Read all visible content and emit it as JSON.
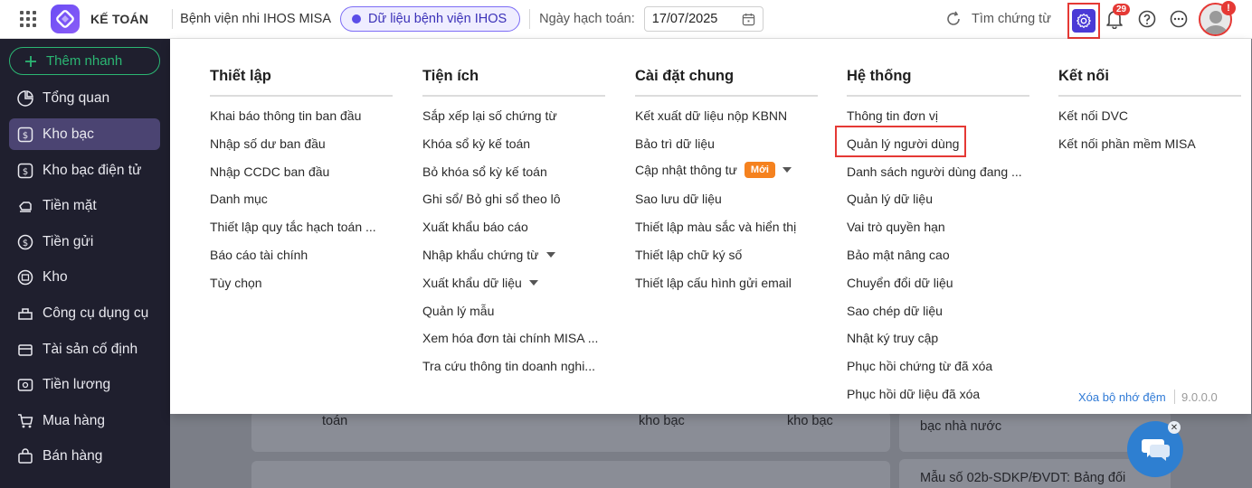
{
  "app": {
    "title": "KẾ TOÁN",
    "unit_name": "Bệnh viện nhi IHOS MISA",
    "data_source": "Dữ liệu bệnh viện IHOS",
    "posting_date_label": "Ngày hạch toán:",
    "posting_date": "17/07/2025",
    "search_doc_label": "Tìm chứng từ",
    "notification_count": "29",
    "avatar_alert": "!"
  },
  "sidebar": {
    "quick_add": "Thêm nhanh",
    "items": [
      {
        "label": "Tổng quan",
        "icon": "pie-chart-icon"
      },
      {
        "label": "Kho bạc",
        "icon": "treasury-icon",
        "active": true
      },
      {
        "label": "Kho bạc điện tử",
        "icon": "e-treasury-icon"
      },
      {
        "label": "Tiền mặt",
        "icon": "cash-icon"
      },
      {
        "label": "Tiền gửi",
        "icon": "deposit-icon"
      },
      {
        "label": "Kho",
        "icon": "warehouse-icon"
      },
      {
        "label": "Công cụ dụng cụ",
        "icon": "tools-icon"
      },
      {
        "label": "Tài sản cố định",
        "icon": "fixed-asset-icon"
      },
      {
        "label": "Tiền lương",
        "icon": "salary-icon"
      },
      {
        "label": "Mua hàng",
        "icon": "cart-icon"
      },
      {
        "label": "Bán hàng",
        "icon": "sales-icon"
      }
    ]
  },
  "background": {
    "text1": "toán",
    "text2": "kho bạc",
    "text3": "kho bạc",
    "text4": "bạc nhà nước",
    "text5": "Mẫu số 02b-SDKP/ĐVDT: Bảng đối"
  },
  "menu": {
    "columns": [
      {
        "title": "Thiết lập",
        "items": [
          {
            "label": "Khai báo thông tin ban đầu"
          },
          {
            "label": "Nhập số dư ban đầu"
          },
          {
            "label": "Nhập CCDC ban đầu"
          },
          {
            "label": "Danh mục"
          },
          {
            "label": "Thiết lập quy tắc hạch toán ..."
          },
          {
            "label": "Báo cáo tài chính"
          },
          {
            "label": "Tùy chọn"
          }
        ]
      },
      {
        "title": "Tiện ích",
        "items": [
          {
            "label": "Sắp xếp lại số chứng từ"
          },
          {
            "label": "Khóa sổ kỳ kế toán"
          },
          {
            "label": "Bỏ khóa sổ kỳ kế toán"
          },
          {
            "label": "Ghi sổ/ Bỏ ghi sổ theo lô"
          },
          {
            "label": "Xuất khẩu báo cáo"
          },
          {
            "label": "Nhập khẩu chứng từ",
            "dropdown": true
          },
          {
            "label": "Xuất khẩu dữ liệu",
            "dropdown": true
          },
          {
            "label": "Quản lý mẫu"
          },
          {
            "label": "Xem hóa đơn tài chính MISA ..."
          },
          {
            "label": "Tra cứu thông tin doanh nghi..."
          }
        ]
      },
      {
        "title": "Cài đặt chung",
        "items": [
          {
            "label": "Kết xuất dữ liệu nộp KBNN"
          },
          {
            "label": "Bảo trì dữ liệu"
          },
          {
            "label": "Cập nhật thông tư",
            "badge": "Mới",
            "dropdown": true
          },
          {
            "label": "Sao lưu dữ liệu"
          },
          {
            "label": "Thiết lập màu sắc và hiển thị"
          },
          {
            "label": "Thiết lập chữ ký số"
          },
          {
            "label": "Thiết lập cấu hình gửi email"
          }
        ]
      },
      {
        "title": "Hệ thống",
        "items": [
          {
            "label": "Thông tin đơn vị"
          },
          {
            "label": "Quản lý người dùng",
            "highlighted": true
          },
          {
            "label": "Danh sách người dùng đang ..."
          },
          {
            "label": "Quản lý dữ liệu"
          },
          {
            "label": "Vai trò quyền hạn"
          },
          {
            "label": "Bảo mật nâng cao"
          },
          {
            "label": "Chuyển đổi dữ liệu"
          },
          {
            "label": "Sao chép dữ liệu"
          },
          {
            "label": "Nhật ký truy cập"
          },
          {
            "label": "Phục hồi chứng từ đã xóa"
          },
          {
            "label": "Phục hồi dữ liệu đã xóa"
          }
        ]
      },
      {
        "title": "Kết nối",
        "items": [
          {
            "label": "Kết nối DVC"
          },
          {
            "label": "Kết nối phần mềm MISA"
          }
        ]
      }
    ],
    "footer": {
      "clear_cache": "Xóa bộ nhớ đệm",
      "version": "9.0.0.0"
    }
  },
  "colors": {
    "accent": "#4a3ad6",
    "highlight_border": "#e53935",
    "new_badge": "#f5821f",
    "sidebar_bg": "#1f1f2e",
    "sidebar_active": "#4b4472",
    "quick_add": "#2bb673"
  }
}
